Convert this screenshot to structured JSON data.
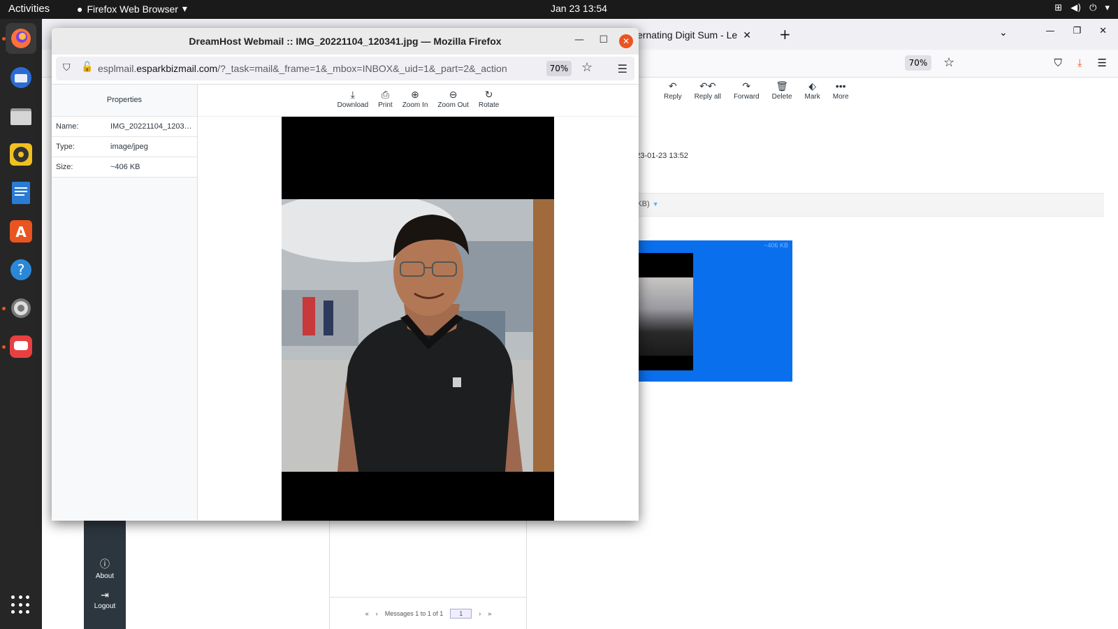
{
  "topbar": {
    "activities": "Activities",
    "app_menu": "Firefox Web Browser",
    "clock": "Jan 23  13:54"
  },
  "dock": {
    "apps": [
      "firefox-icon",
      "thunderbird-icon",
      "files-icon",
      "rhythmbox-icon",
      "writer-icon",
      "app-center-icon",
      "help-icon",
      "settings-icon",
      "chat-icon"
    ]
  },
  "background_window": {
    "tab_title": "lternating Digit Sum - Le",
    "zoom": "70%",
    "toolbar": {
      "reply": "Reply",
      "reply_all": "Reply all",
      "forward": "Forward",
      "delete": "Delete",
      "mark": "Mark",
      "more": "More"
    },
    "date": "2023-01-23 13:52",
    "attachment_size": "06 KB)",
    "thumb_size": "~406 KB",
    "sidebar": {
      "about": "About",
      "logout": "Logout"
    },
    "footer": {
      "messages": "Messages 1 to 1 of 1",
      "page": "1"
    }
  },
  "popup": {
    "title": "DreamHost Webmail :: IMG_20221104_120341.jpg — Mozilla Firefox",
    "url_pre": "esplmail.",
    "url_domain": "esparkbizmail.com",
    "url_post": "/?_task=mail&_frame=1&_mbox=INBOX&_uid=1&_part=2&_action",
    "zoom": "70%",
    "properties": {
      "header": "Properties",
      "rows": [
        {
          "key": "Name:",
          "value": "IMG_20221104_120341.jpg"
        },
        {
          "key": "Type:",
          "value": "image/jpeg"
        },
        {
          "key": "Size:",
          "value": "~406 KB"
        }
      ]
    },
    "viewer_tools": {
      "download": "Download",
      "print": "Print",
      "zoom_in": "Zoom In",
      "zoom_out": "Zoom Out",
      "rotate": "Rotate"
    }
  },
  "colors": {
    "ubuntu_orange": "#e95420",
    "roundcube_dark": "#2c363f",
    "attachment_blue": "#0a6fed"
  }
}
